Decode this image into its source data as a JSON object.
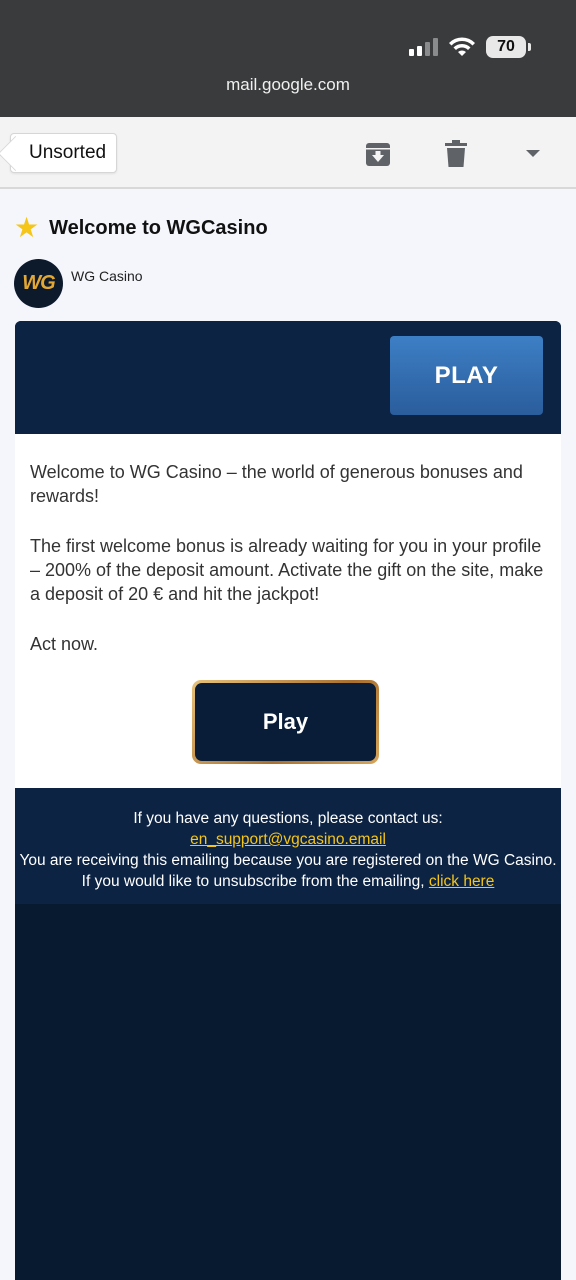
{
  "status_bar": {
    "battery": "70"
  },
  "browser": {
    "url": "mail.google.com"
  },
  "toolbar": {
    "back_label": "Unsorted"
  },
  "message": {
    "subject": "Welcome to WGCasino",
    "sender_name": "WG Casino",
    "avatar_text": "WG"
  },
  "email": {
    "top_button": "PLAY",
    "paragraph_1": "Welcome to WG Casino – the world of generous bonuses and rewards!",
    "paragraph_2": "The first welcome bonus is already waiting for you in your profile – 200% of the deposit amount. Activate the gift on the site, make a deposit of 20 € and hit the jackpot!",
    "paragraph_3": "Act now.",
    "main_button": "Play",
    "footer_line_1": "If you have any questions, please contact us:",
    "footer_email": "en_support@vgcasino.email",
    "footer_line_2": "You are receiving this emailing because you are registered on the WG Casino. If you would like to unsubscribe from the emailing,",
    "footer_link": "click here"
  },
  "colors": {
    "status_bar_bg": "#3a3b3d",
    "email_dark_bg": "#081a30",
    "header_navy": "#0c2344",
    "play_blue": "#3d7fc5",
    "link_yellow": "#f5c518"
  }
}
